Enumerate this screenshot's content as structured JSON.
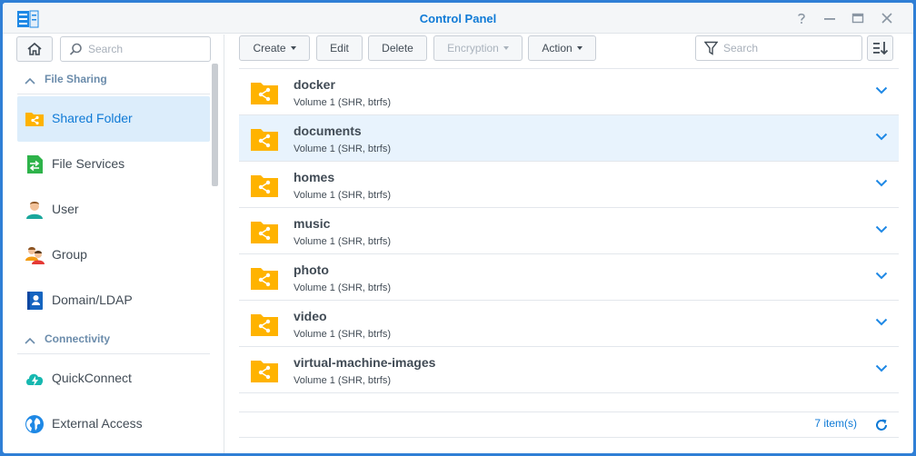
{
  "window": {
    "title": "Control Panel"
  },
  "sidebar": {
    "search_placeholder": "Search",
    "sections": [
      {
        "label": "File Sharing"
      },
      {
        "label": "Connectivity"
      }
    ],
    "items": [
      {
        "label": "Shared Folder",
        "icon": "shared-folder-icon",
        "active": true
      },
      {
        "label": "File Services",
        "icon": "file-services-icon"
      },
      {
        "label": "User",
        "icon": "user-icon"
      },
      {
        "label": "Group",
        "icon": "group-icon"
      },
      {
        "label": "Domain/LDAP",
        "icon": "domain-ldap-icon"
      },
      {
        "label": "QuickConnect",
        "icon": "quickconnect-icon"
      },
      {
        "label": "External Access",
        "icon": "external-access-icon"
      }
    ]
  },
  "toolbar": {
    "create_label": "Create",
    "edit_label": "Edit",
    "delete_label": "Delete",
    "encryption_label": "Encryption",
    "action_label": "Action",
    "search_placeholder": "Search"
  },
  "folders": [
    {
      "name": "docker",
      "volume": "Volume 1 (SHR, btrfs)"
    },
    {
      "name": "documents",
      "volume": "Volume 1 (SHR, btrfs)",
      "selected": true
    },
    {
      "name": "homes",
      "volume": "Volume 1 (SHR, btrfs)"
    },
    {
      "name": "music",
      "volume": "Volume 1 (SHR, btrfs)"
    },
    {
      "name": "photo",
      "volume": "Volume 1 (SHR, btrfs)"
    },
    {
      "name": "video",
      "volume": "Volume 1 (SHR, btrfs)"
    },
    {
      "name": "virtual-machine-images",
      "volume": "Volume 1 (SHR, btrfs)"
    }
  ],
  "footer": {
    "count_label": "7 item(s)"
  },
  "colors": {
    "accent": "#0f7ad6",
    "folder": "#ffb300",
    "selected_row": "#e8f3fd",
    "active_nav": "#dcedfb",
    "desktop": "#2f7fd6"
  }
}
